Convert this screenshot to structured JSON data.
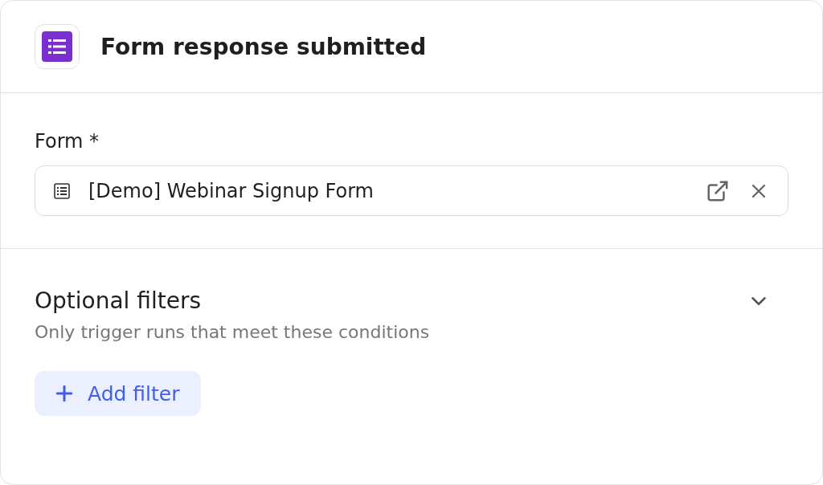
{
  "header": {
    "title": "Form response submitted"
  },
  "form_field": {
    "label": "Form *",
    "value": "[Demo] Webinar Signup Form"
  },
  "filters": {
    "title": "Optional filters",
    "description": "Only trigger runs that meet these conditions",
    "add_button": "Add filter"
  }
}
